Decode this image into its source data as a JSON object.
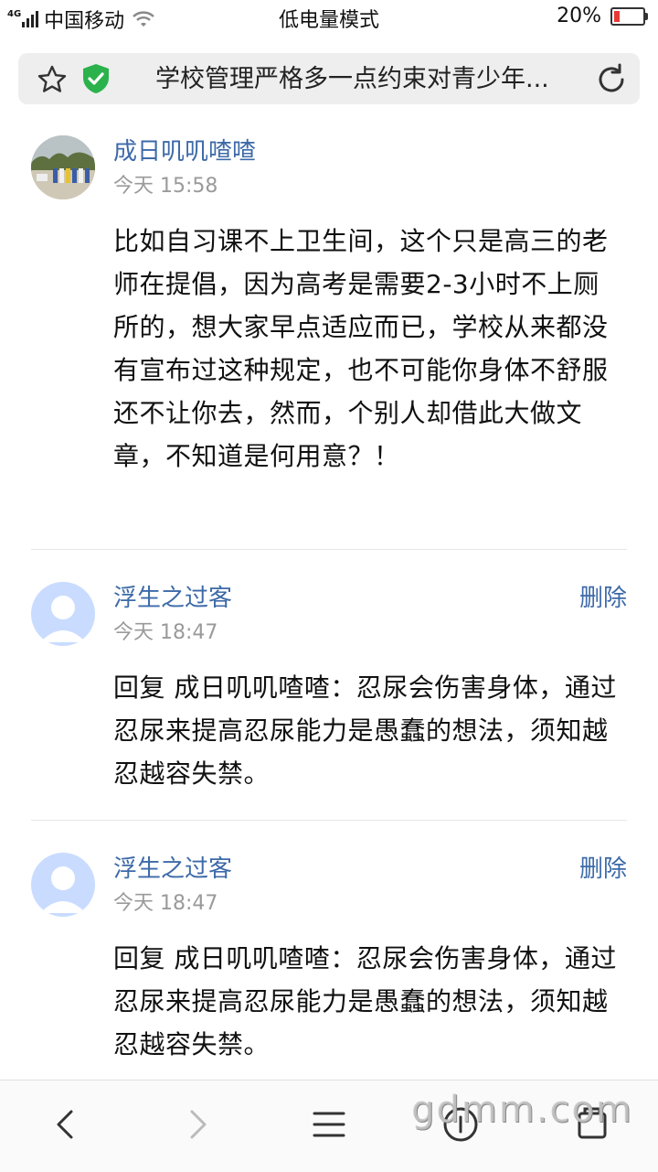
{
  "status_bar": {
    "network": "4G",
    "carrier": "中国移动",
    "mode": "低电量模式",
    "battery_text": "20%",
    "battery_level": 0.2
  },
  "address_bar": {
    "title": "学校管理严格多一点约束对青少年..."
  },
  "comments": [
    {
      "username": "成日叽叽喳喳",
      "time": "今天 15:58",
      "text": "比如自习课不上卫生间，这个只是高三的老师在提倡，因为高考是需要2-3小时不上厕所的，想大家早点适应而已，学校从来都没有宣布过这种规定，也不可能你身体不舒服还不让你去，然而，个别人却借此大做文章，不知道是何用意？！"
    },
    {
      "username": "浮生之过客",
      "time": "今天 18:47",
      "delete_label": "删除",
      "text": "回复 成日叽叽喳喳：忍尿会伤害身体，通过忍尿来提高忍尿能力是愚蠢的想法，须知越忍越容失禁。"
    },
    {
      "username": "浮生之过客",
      "time": "今天 18:47",
      "delete_label": "删除",
      "text": "回复 成日叽叽喳喳：忍尿会伤害身体，通过忍尿来提高忍尿能力是愚蠢的想法，须知越忍越容失禁。"
    }
  ],
  "watermark": "gdmm.com",
  "colors": {
    "link": "#3d6aa8",
    "shield": "#2bb24c",
    "battery_low": "#e53935"
  }
}
